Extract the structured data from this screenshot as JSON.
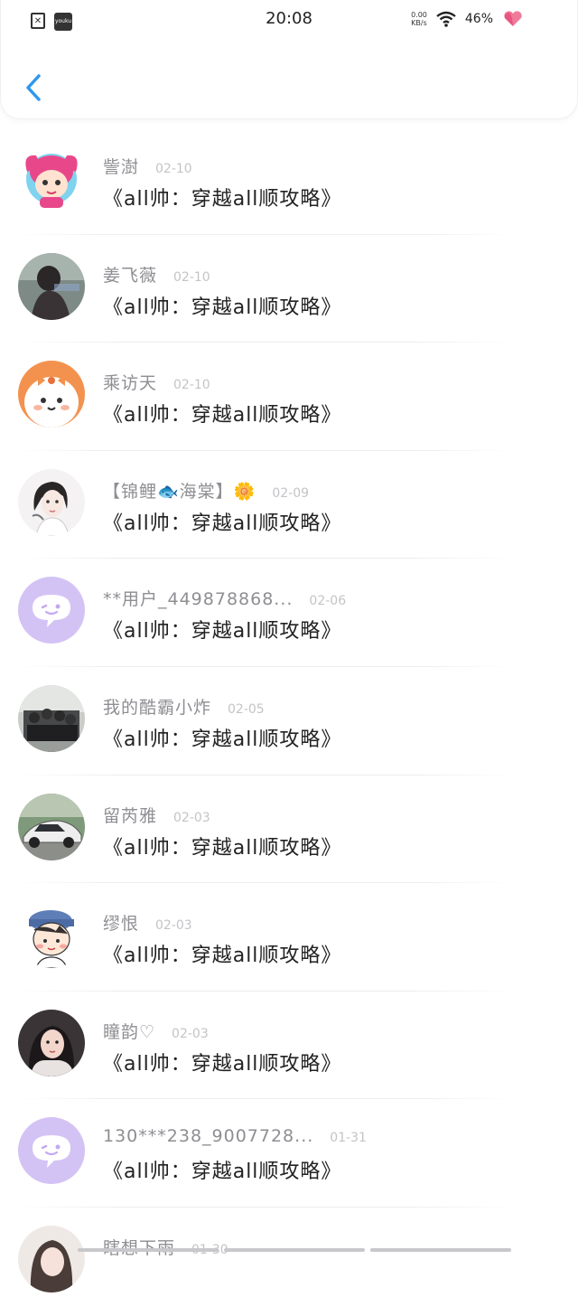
{
  "status_bar": {
    "time": "20:08",
    "app_label": "youku",
    "speed_value": "0.00",
    "speed_unit": "KB/s",
    "battery": "46%",
    "icons": [
      "sim-alert-icon",
      "youku-app-icon",
      "wifi-icon",
      "heart-battery-icon"
    ]
  },
  "header": {
    "back_icon": "chevron-left-icon",
    "accent": "#2e97ee"
  },
  "list": {
    "items": [
      {
        "name": "訾澍",
        "date": "02-10",
        "title": "《all帅：穿越all顺攻略》",
        "avatar": "cartoon-pink"
      },
      {
        "name": "姜飞薇",
        "date": "02-10",
        "title": "《all帅：穿越all顺攻略》",
        "avatar": "photo-dark"
      },
      {
        "name": "乘访天",
        "date": "02-10",
        "title": "《all帅：穿越all顺攻略》",
        "avatar": "cartoon-orange"
      },
      {
        "name": "【锦鲤🐟海棠】🌼",
        "date": "02-09",
        "title": "《all帅：穿越all顺攻略》",
        "avatar": "sketch-girl"
      },
      {
        "name": "**用户_449878868...",
        "date": "02-06",
        "title": "《all帅：穿越all顺攻略》",
        "avatar": "default-purple"
      },
      {
        "name": "我的酷霸小炸",
        "date": "02-05",
        "title": "《all帅：穿越all顺攻略》",
        "avatar": "photo-group"
      },
      {
        "name": "留芮雅",
        "date": "02-03",
        "title": "《all帅：穿越all顺攻略》",
        "avatar": "photo-car"
      },
      {
        "name": "缪恨",
        "date": "02-03",
        "title": "《all帅：穿越all顺攻略》",
        "avatar": "cartoon-boy"
      },
      {
        "name": "瞳韵♡",
        "date": "02-03",
        "title": "《all帅：穿越all顺攻略》",
        "avatar": "photo-girl"
      },
      {
        "name": "130***238_9007728...",
        "date": "01-31",
        "title": "《all帅：穿越all顺攻略》",
        "avatar": "default-purple"
      },
      {
        "name": "瞎想下雨",
        "date": "01-30",
        "title": "",
        "avatar": "photo-partial"
      }
    ]
  }
}
